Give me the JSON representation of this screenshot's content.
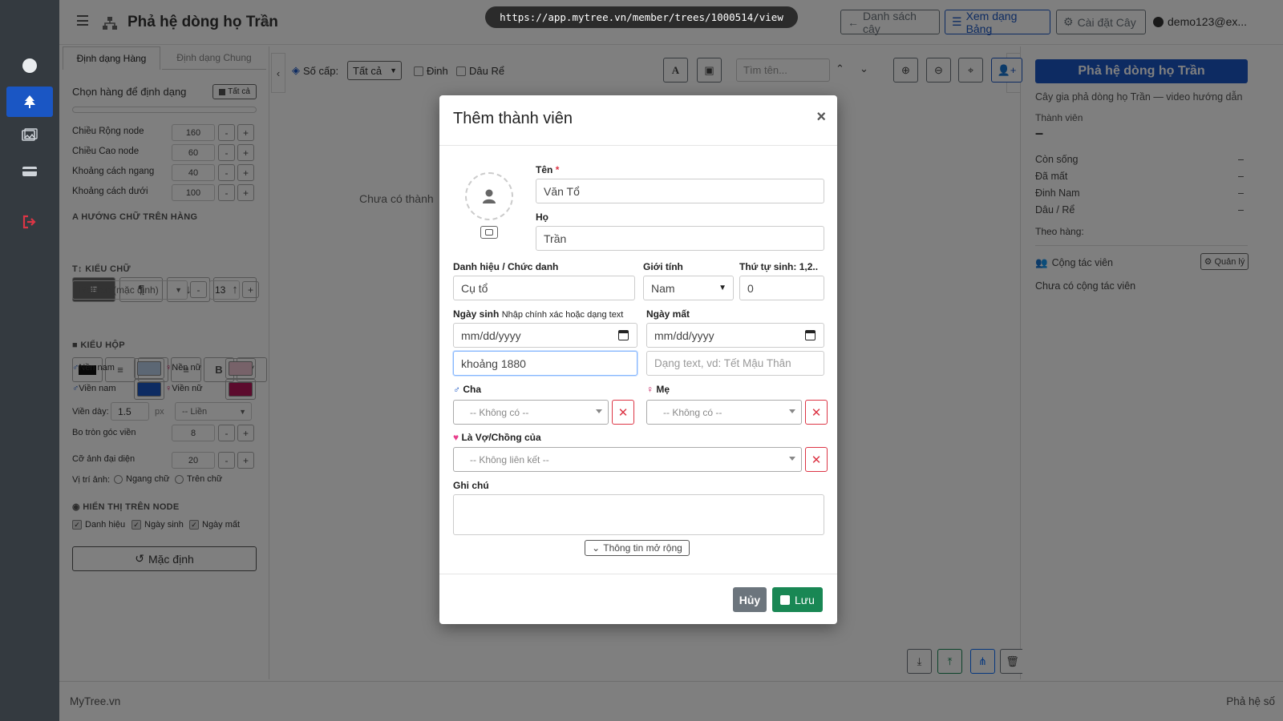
{
  "url_bar": "https://app.mytree.vn/member/trees/1000514/view",
  "header": {
    "title": "Phả hệ dòng họ Trần",
    "buttons": {
      "tree_list": "Danh sách cây",
      "table_view": "Xem dạng Bảng",
      "tree_settings": "Cài đặt Cây"
    },
    "user": "demo123@ex..."
  },
  "left_panel": {
    "tabs": [
      "Định dạng Hàng",
      "Định dạng Chung"
    ],
    "select_rows_label": "Chọn hàng để định dạng",
    "select_all": "Tất cả",
    "node_width_label": "Chiều Rộng node",
    "node_width": "160",
    "node_height_label": "Chiều Cao node",
    "node_height": "60",
    "h_spacing_label": "Khoảng cách ngang",
    "h_spacing": "40",
    "v_spacing_label": "Khoảng cách dưới",
    "v_spacing": "100",
    "text_direction_title": "HƯỚNG CHỮ TRÊN HÀNG",
    "font_style_title": "KIỂU CHỮ",
    "font_family": "Roboto (mặc định)",
    "font_size": "13",
    "box_style_title": "KIỂU HỘP",
    "bg_male_label": "Nền nam",
    "bg_female_label": "Nền nữ",
    "border_male_label": "Viền nam",
    "border_female_label": "Viền nữ",
    "border_width_label": "Viền dày:",
    "border_width": "1.5",
    "border_width_unit": "px",
    "border_style": "-- Liền",
    "radius_label": "Bo tròn góc viền",
    "radius": "8",
    "avatar_size_label": "Cỡ ảnh đại diện",
    "avatar_size": "20",
    "image_pos_label": "Vị trí ảnh:",
    "image_pos_opt1": "Ngang chữ",
    "image_pos_opt2": "Trên chữ",
    "display_title": "HIỂN THỊ TRÊN NODE",
    "show_title": "Danh hiệu",
    "show_birth": "Ngày sinh",
    "show_death": "Ngày mất",
    "reset_button": "Mặc định",
    "colors": {
      "bg_male": "#b8cfe8",
      "bg_female": "#efc4d2",
      "border_male": "#1a56c4",
      "border_female": "#b8165a"
    }
  },
  "center": {
    "level_label": "Số cấp:",
    "level_value": "Tất cả",
    "check_pin": "Đinh",
    "check_root": "Dâu Rể",
    "search_placeholder": "Tìm tên...",
    "empty_text": "Chưa có thành"
  },
  "right_panel": {
    "title": "Phả hệ dòng họ Trần",
    "subtitle": "Cây gia phả dòng họ Trần — video hướng dẫn",
    "members_label": "Thành viên",
    "members_value": "–",
    "alive_label": "Còn sống",
    "alive_value": "–",
    "dead_label": "Đã mất",
    "dead_value": "–",
    "male_label": "Đinh Nam",
    "male_value": "–",
    "inlaw_label": "Dâu / Rể",
    "inlaw_value": "–",
    "by_row_label": "Theo hàng:",
    "collab_label": "Cộng tác viên",
    "manage_button": "Quản lý",
    "no_collab": "Chưa có cộng tác viên"
  },
  "footer": {
    "left": "MyTree.vn",
    "right": "Phả hệ số"
  },
  "modal": {
    "title": "Thêm thành viên",
    "first_name_label": "Tên",
    "required_mark": "*",
    "first_name": "Văn Tổ",
    "last_name_label": "Họ",
    "last_name": "Trần",
    "title_label": "Danh hiệu / Chức danh",
    "title_value": "Cụ tổ",
    "gender_label": "Giới tính",
    "gender_value": "Nam",
    "order_label": "Thứ tự sinh: 1,2..",
    "order_value": "0",
    "birth_label": "Ngày sinh",
    "birth_hint": "Nhập chính xác hoặc dạng text",
    "birth_date_placeholder": "mm/dd/yyyy",
    "birth_text": "khoảng 1880",
    "death_label": "Ngày mất",
    "death_date_placeholder": "mm/dd/yyyy",
    "death_text_placeholder": "Dạng text, vd: Tết Mậu Thân",
    "father_label": "Cha",
    "father_value": "-- Không có --",
    "mother_label": "Mẹ",
    "mother_value": "-- Không có --",
    "spouse_label": "Là Vợ/Chồng của",
    "spouse_value": "-- Không liên kết --",
    "notes_label": "Ghi chú",
    "notes_value": "",
    "expand_button": "Thông tin mở rộng",
    "cancel_button": "Hủy",
    "save_button": "Lưu"
  }
}
